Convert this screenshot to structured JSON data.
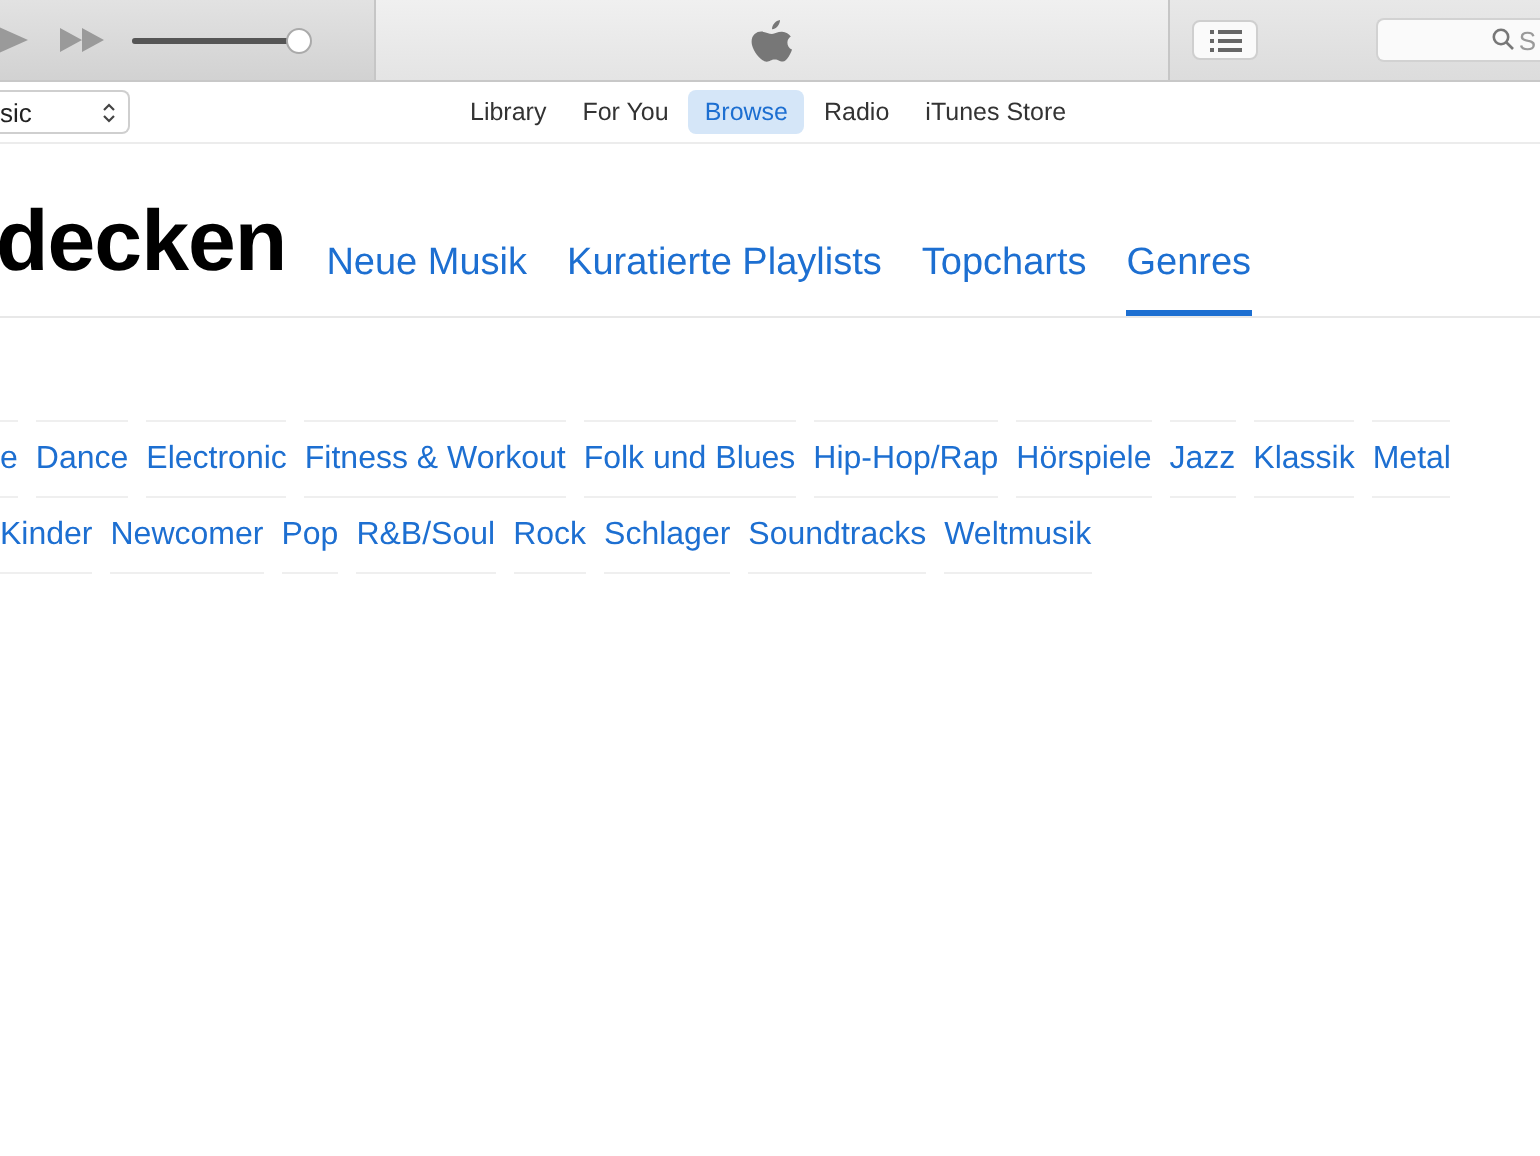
{
  "toolbar": {
    "volume": {
      "level": 1.0
    },
    "search": {
      "placeholder": "S"
    }
  },
  "nav": {
    "source": "sic",
    "tabs": [
      {
        "label": "Library",
        "selected": false
      },
      {
        "label": "For You",
        "selected": false
      },
      {
        "label": "Browse",
        "selected": true
      },
      {
        "label": "Radio",
        "selected": false
      },
      {
        "label": "iTunes Store",
        "selected": false
      }
    ]
  },
  "header": {
    "title": "decken",
    "tabs": [
      {
        "label": "Neue Musik",
        "selected": false
      },
      {
        "label": "Kuratierte Playlists",
        "selected": false
      },
      {
        "label": "Topcharts",
        "selected": false
      },
      {
        "label": "Genres",
        "selected": true
      }
    ]
  },
  "genres": [
    [
      "e",
      "Dance",
      "Electronic",
      "Fitness & Workout",
      "Folk und Blues",
      "Hip-Hop/Rap",
      "Hörspiele",
      "Jazz",
      "Klassik",
      "Metal"
    ],
    [
      "Kinder",
      "Newcomer",
      "Pop",
      "R&B/Soul",
      "Rock",
      "Schlager",
      "Soundtracks",
      "Weltmusik"
    ]
  ]
}
